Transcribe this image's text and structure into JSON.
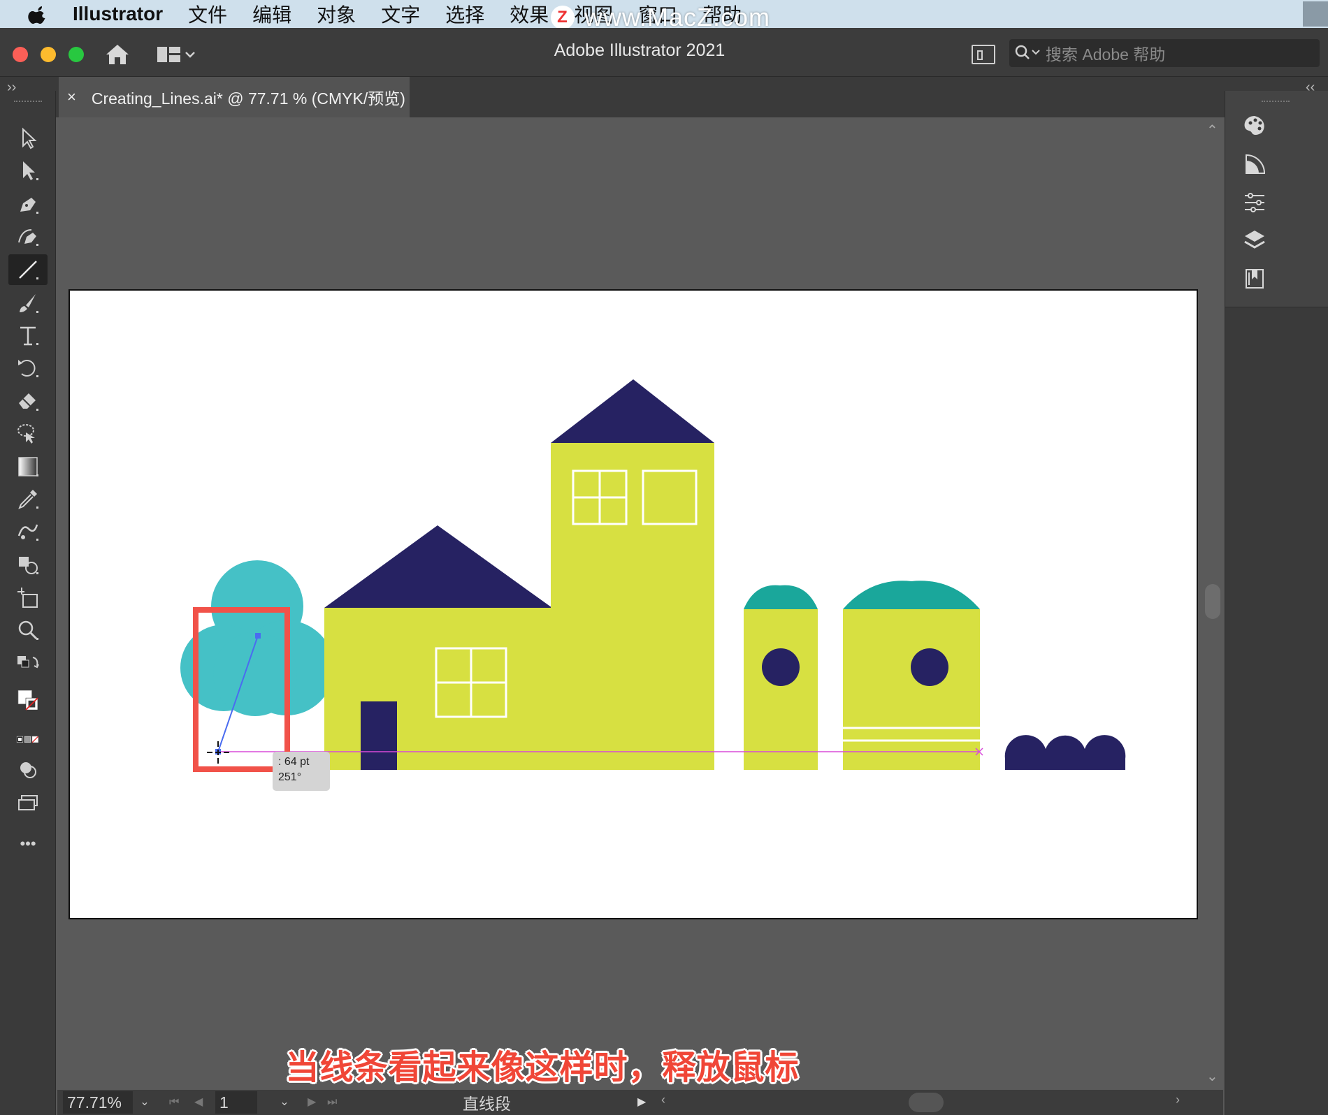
{
  "menubar": {
    "app_name": "Illustrator",
    "items": [
      "文件",
      "编辑",
      "对象",
      "文字",
      "选择",
      "效果",
      "视图",
      "窗口",
      "帮助"
    ],
    "watermark": "www.MacZ.com",
    "watermark_badge": "Z"
  },
  "window": {
    "title": "Adobe Illustrator 2021",
    "search_placeholder": "搜索 Adobe 帮助"
  },
  "tabs": {
    "collapse_left": "››",
    "collapse_right": "‹‹",
    "document": {
      "close": "×",
      "label": "Creating_Lines.ai* @ 77.71 % (CMYK/预览)"
    }
  },
  "toolbar": {
    "tools": [
      {
        "name": "selection-tool",
        "icon": "arrow-icon"
      },
      {
        "name": "direct-selection-tool",
        "icon": "solid-arrow-icon"
      },
      {
        "name": "pen-tool",
        "icon": "pen-icon"
      },
      {
        "name": "curvature-tool",
        "icon": "curvature-pen-icon"
      },
      {
        "name": "line-segment-tool",
        "icon": "line-icon",
        "active": true
      },
      {
        "name": "paintbrush-tool",
        "icon": "brush-icon"
      },
      {
        "name": "type-tool",
        "icon": "type-icon"
      },
      {
        "name": "rotate-tool",
        "icon": "rotate-icon"
      },
      {
        "name": "eraser-tool",
        "icon": "eraser-icon"
      },
      {
        "name": "lasso-tool",
        "icon": "lasso-icon"
      },
      {
        "name": "gradient-tool",
        "icon": "gradient-icon"
      },
      {
        "name": "eyedropper-tool",
        "icon": "eyedropper-icon"
      },
      {
        "name": "puppet-warp-tool",
        "icon": "warp-icon"
      },
      {
        "name": "shape-builder-tool",
        "icon": "shape-builder-icon"
      },
      {
        "name": "artboard-tool",
        "icon": "artboard-icon"
      },
      {
        "name": "zoom-tool",
        "icon": "magnifier-icon"
      }
    ],
    "more": "•••"
  },
  "right_panel": {
    "icons": [
      "color-palette-icon",
      "color-guide-icon",
      "properties-icon",
      "layers-icon",
      "libraries-icon"
    ]
  },
  "canvas": {
    "tooltip_line1": ": 64 pt",
    "tooltip_line2": "251°",
    "colors": {
      "navy": "#262262",
      "yellow": "#d7e041",
      "teal": "#45c1c6",
      "dark_teal": "#1aa79b",
      "highlight": "#f15249",
      "guide": "#d84bd8",
      "line": "#4a6cf0"
    }
  },
  "caption": "当线条看起来像这样时，释放鼠标",
  "statusbar": {
    "zoom": "77.71%",
    "page": "1",
    "tool_name": "直线段",
    "first": "⏮",
    "prev": "◀",
    "next": "▶",
    "last": "⏭",
    "play": "▶",
    "chevron": "⌄"
  },
  "scroll": {
    "up": "⌃",
    "down": "⌄",
    "left": "‹",
    "right": "›"
  }
}
